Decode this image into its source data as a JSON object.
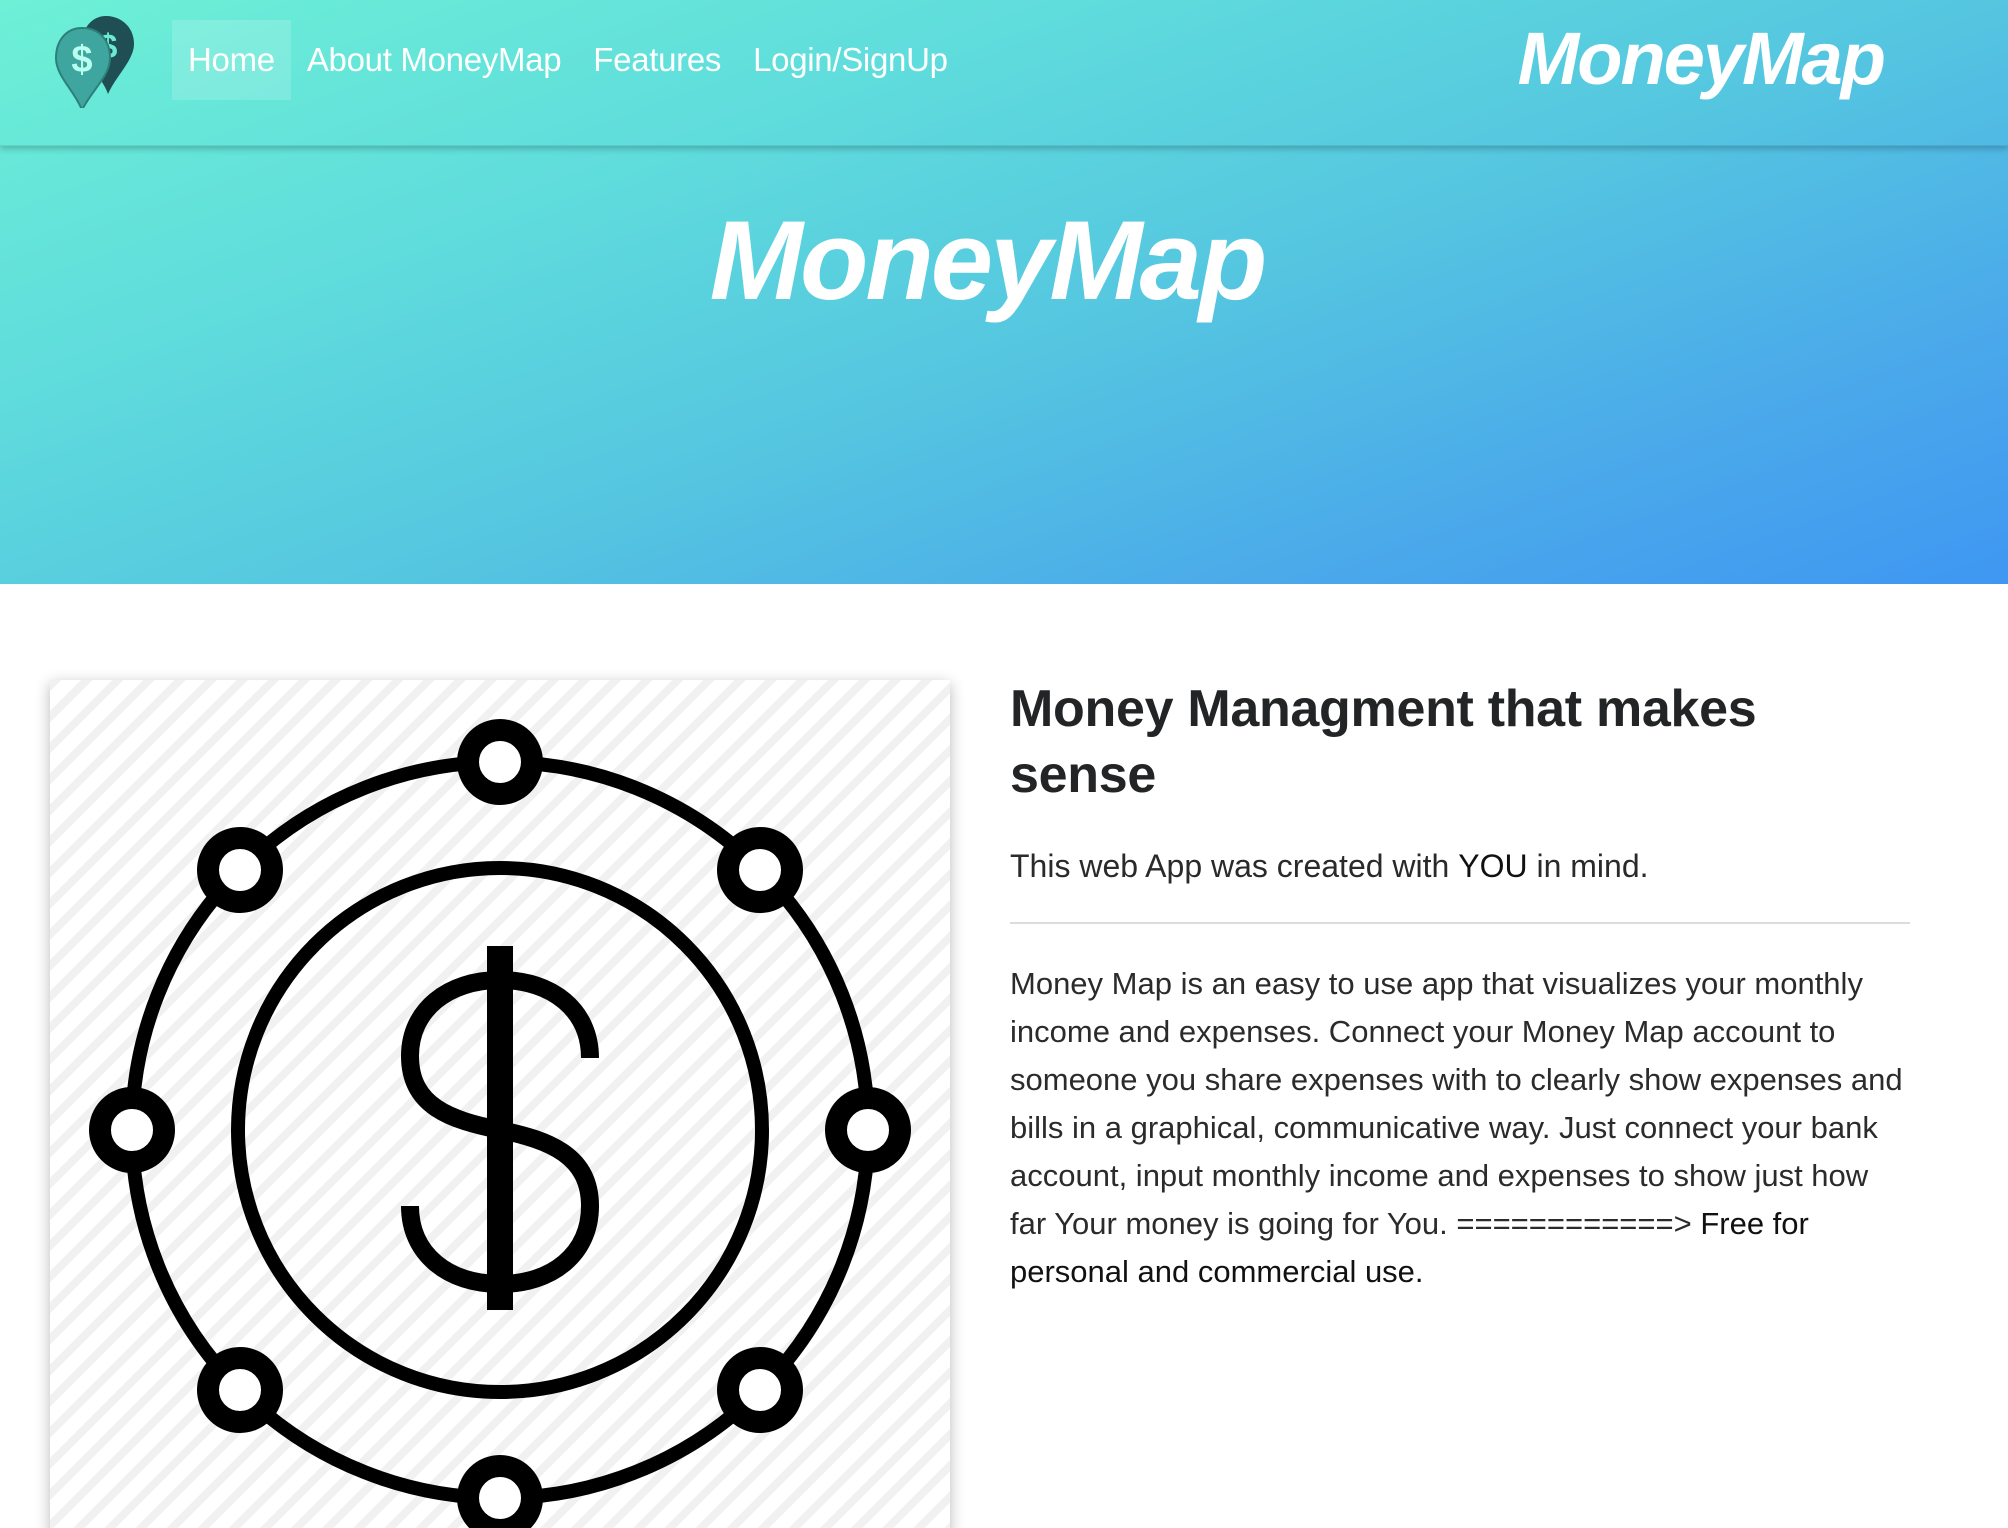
{
  "navbar": {
    "logo_icon": "dollar-map-pin-icon",
    "links": [
      {
        "label": "Home",
        "active": true
      },
      {
        "label": "About MoneyMap",
        "active": false
      },
      {
        "label": "Features",
        "active": false
      },
      {
        "label": "Login/SignUp",
        "active": false
      }
    ],
    "brand": "MoneyMap"
  },
  "hero": {
    "title": "MoneyMap"
  },
  "main": {
    "image_icon": "dollar-coin-network-icon",
    "heading": "Money Managment that makes sense",
    "lead_prefix": "This web App was created with ",
    "lead_strong": "YOU",
    "lead_suffix": " in mind.",
    "body": "Money Map is an easy to use app that visualizes your monthly income and expenses. Connect your Money Map account to someone you share expenses with to clearly show expenses and bills in a graphical, communicative way. Just connect your bank account, input monthly income and expenses to show just how far Your money is going for You. ============> ",
    "body_emphasis": "Free for personal and commercial use."
  },
  "colors": {
    "gradient_start": "#6df0d6",
    "gradient_end": "#3f97f2",
    "nav_text": "#ffffff",
    "logo_pin_front": "#3fa69f",
    "logo_pin_back": "#1f4e55",
    "text_dark": "#212529"
  }
}
